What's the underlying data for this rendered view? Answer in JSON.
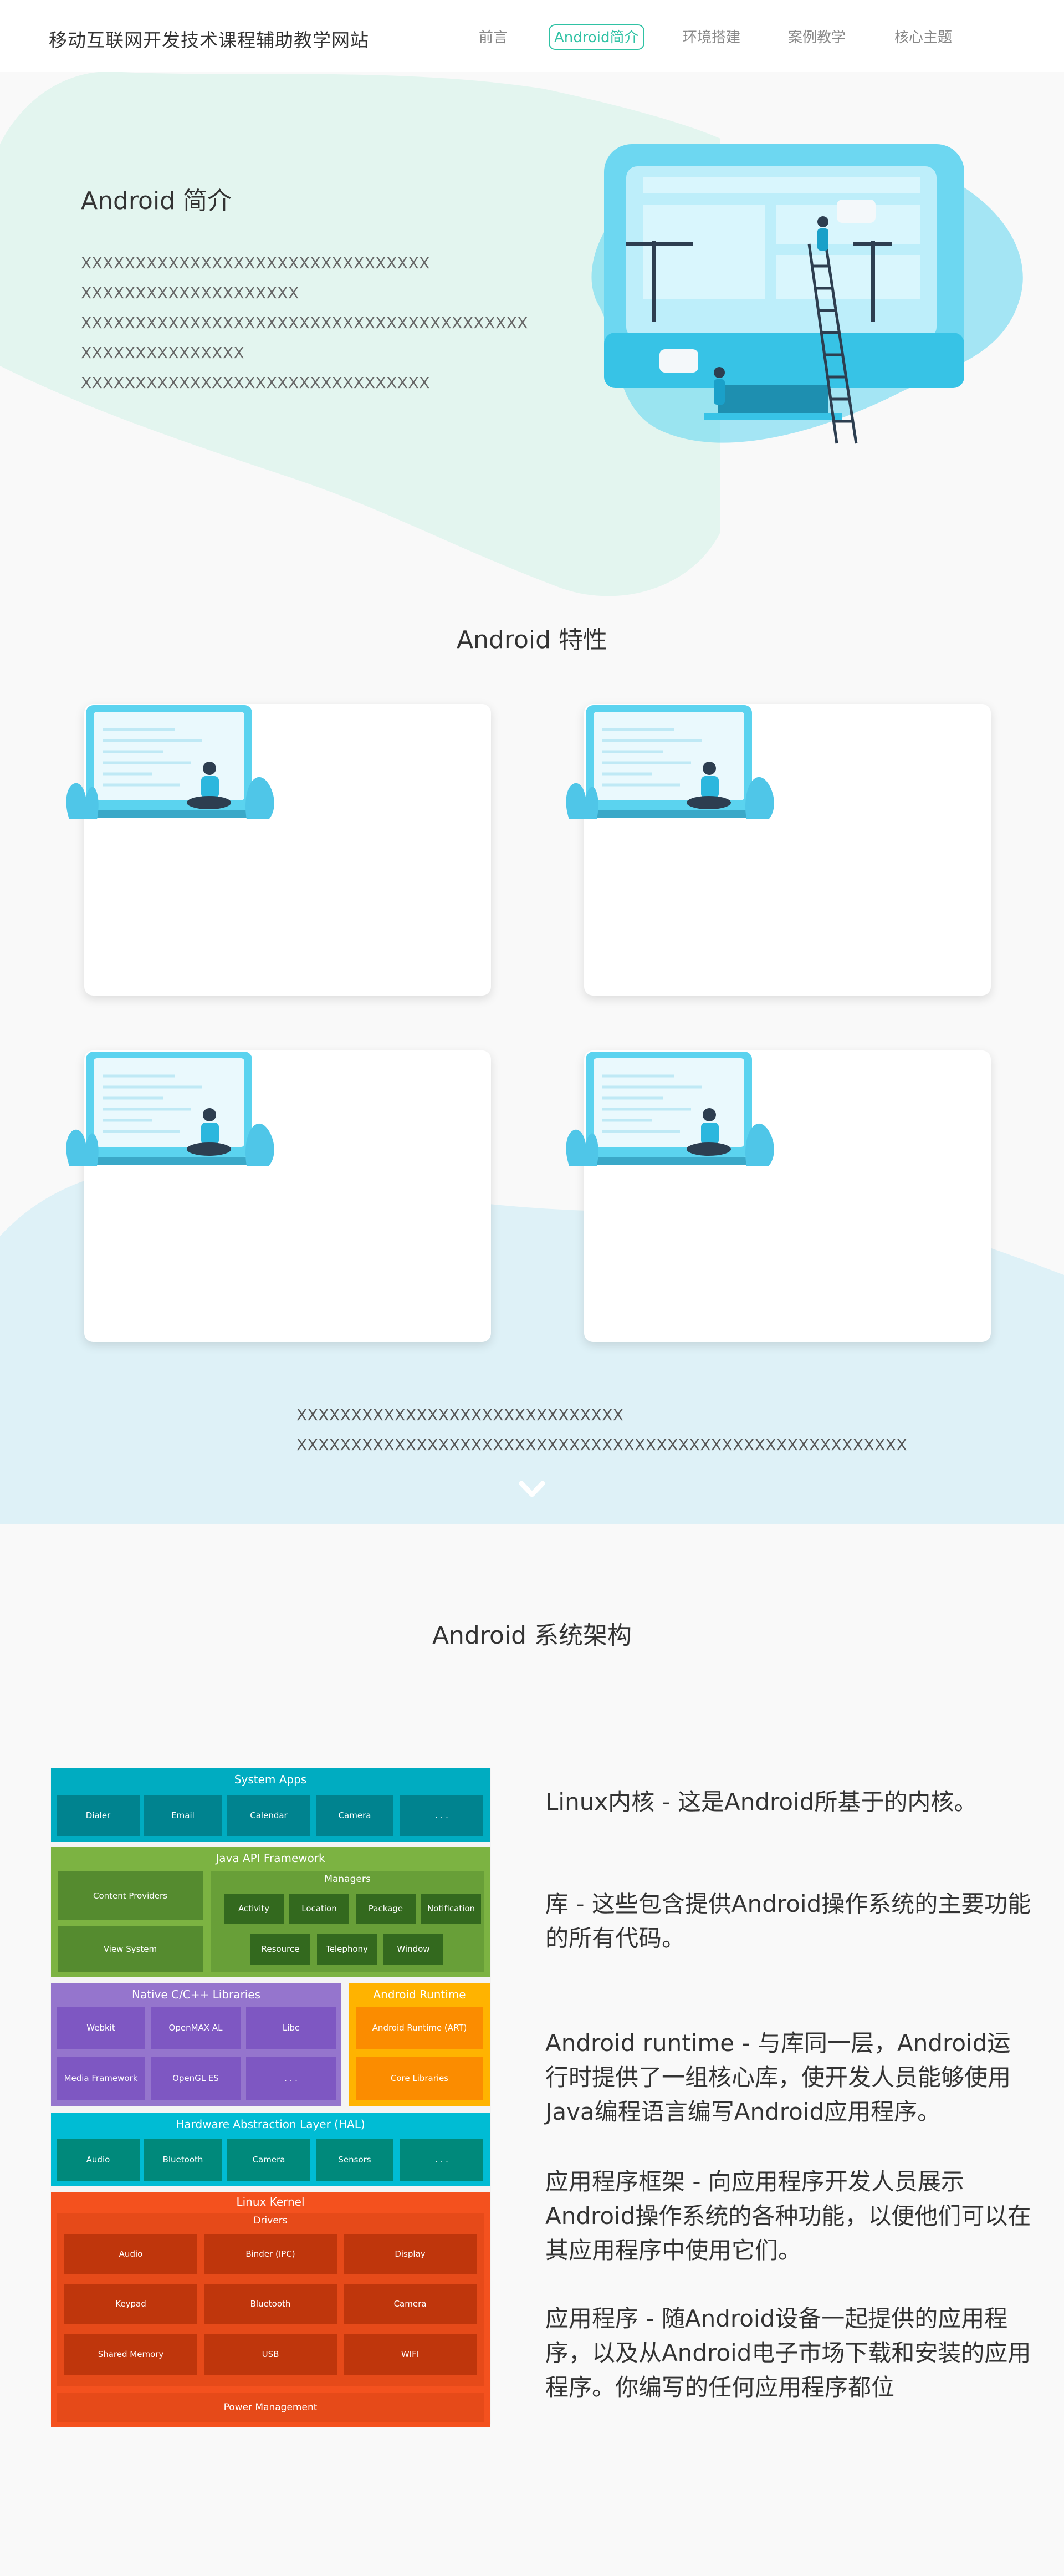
{
  "nav": {
    "brand": "移动互联网开发技术课程辅助教学网站",
    "items": [
      {
        "label": "前言",
        "active": false
      },
      {
        "label": "Android简介",
        "active": true
      },
      {
        "label": "环境搭建",
        "active": false
      },
      {
        "label": "案例教学",
        "active": false
      },
      {
        "label": "核心主题",
        "active": false
      }
    ]
  },
  "hero": {
    "title": "Android 简介",
    "lines": [
      "XXXXXXXXXXXXXXXXXXXXXXXXXXXXXXXX",
      "XXXXXXXXXXXXXXXXXXXX",
      "XXXXXXXXXXXXXXXXXXXXXXXXXXXXXXXXXXXXXXXXX",
      "XXXXXXXXXXXXXXX",
      "XXXXXXXXXXXXXXXXXXXXXXXXXXXXXXXX"
    ]
  },
  "features": {
    "title": "Android 特性",
    "lines": [
      "XXXXXXXXXXXXXXXXXXXXXXXXXXXXXX",
      "XXXXXXXXXXXXXXXXXXXXXXXXXXXXXXXXXXXXXXXXXXXXXXXXXXXXXXXX"
    ]
  },
  "architecture": {
    "title": "Android 系统架构",
    "descriptions": [
      "Linux内核 - 这是Android所基于的内核。",
      "库 - 这些包含提供Android操作系统的主要功能的所有代码。",
      "Android runtime - 与库同一层，Android运行时提供了一组核心库，使开发人员能够使用Java编程语言编写Android应用程序。",
      "应用程序框架 - 向应用程序开发人员展示Android操作系统的各种功能，以便他们可以在其应用程序中使用它们。",
      "应用程序 - 随Android设备一起提供的应用程序，以及从Android电子市场下载和安装的应用程序。你编写的任何应用程序都位"
    ],
    "diagram": {
      "system_apps": {
        "title": "System Apps",
        "cells": [
          "Dialer",
          "Email",
          "Calendar",
          "Camera",
          ". . ."
        ]
      },
      "java_api": {
        "title": "Java API Framework",
        "left": [
          "Content Providers",
          "View System"
        ],
        "managers_title": "Managers",
        "managers_row1": [
          "Activity",
          "Location",
          "Package",
          "Notification"
        ],
        "managers_row2": [
          "Resource",
          "Telephony",
          "Window"
        ]
      },
      "native": {
        "title": "Native C/C++ Libraries",
        "cells": [
          "Webkit",
          "OpenMAX AL",
          "Libc",
          "Media Framework",
          "OpenGL ES",
          ". . ."
        ]
      },
      "runtime": {
        "title": "Android Runtime",
        "cells": [
          "Android Runtime (ART)",
          "Core Libraries"
        ]
      },
      "hal": {
        "title": "Hardware Abstraction Layer (HAL)",
        "cells": [
          "Audio",
          "Bluetooth",
          "Camera",
          "Sensors",
          ". . ."
        ]
      },
      "kernel": {
        "title": "Linux Kernel",
        "drivers_title": "Drivers",
        "drivers": [
          "Audio",
          "Binder (IPC)",
          "Display",
          "Keypad",
          "Bluetooth",
          "Camera",
          "Shared Memory",
          "USB",
          "WIFI"
        ],
        "power": "Power Management"
      }
    }
  },
  "colors": {
    "accent": "#2fc2a4",
    "blob_green": "#e3f5ef",
    "blob_blue": "#def1f7",
    "apps": "#00acc1",
    "java": "#7cb342",
    "native": "#9575cd",
    "runtime": "#ffb300",
    "hal": "#00bcd4",
    "kernel": "#f4511e"
  }
}
